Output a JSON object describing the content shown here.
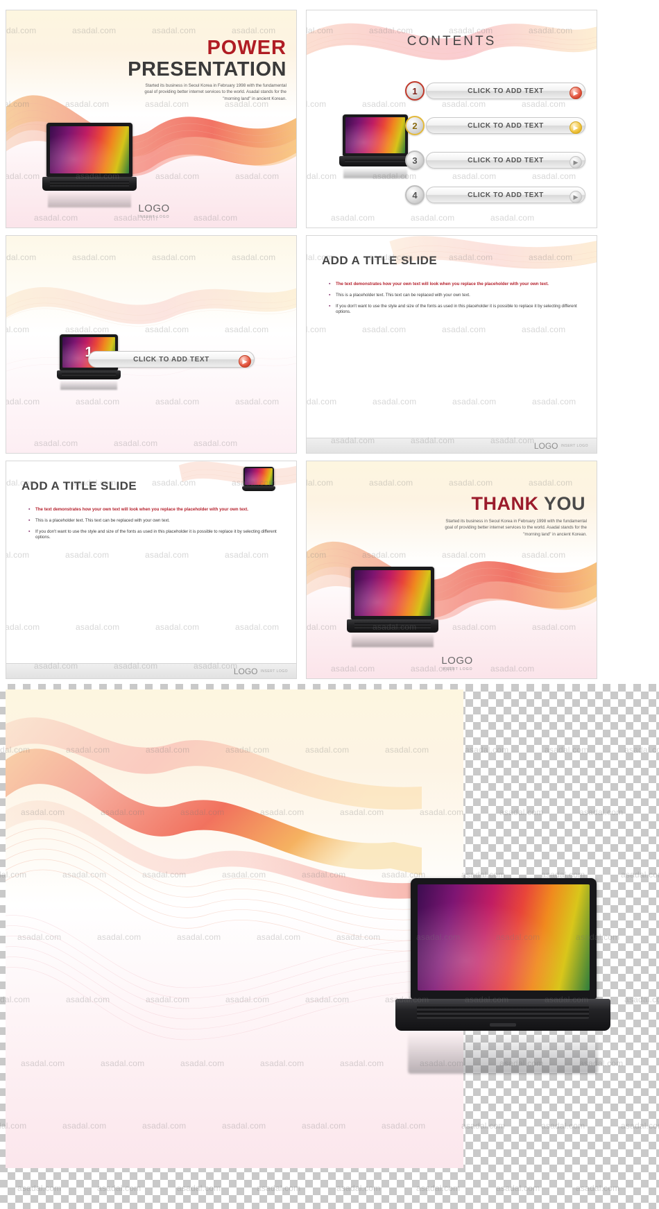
{
  "meta": {
    "watermark_text": "asadal.com"
  },
  "slides": [
    {
      "id": "slide-cover",
      "title_line1": "POWER",
      "title_line2": "PRESENTATION",
      "body": "Started its business in Seoul Korea in February 1998 with the fundamental goal of providing better internet services to the world. Asadal stands for the \"morning land\" in ancient Korean.",
      "logo": "LOGO",
      "logo_sub": "INSERT LOGO"
    },
    {
      "id": "slide-contents",
      "title": "CONTENTS",
      "rows": [
        {
          "num": "1",
          "label": "CLICK TO ADD TEXT"
        },
        {
          "num": "2",
          "label": "CLICK TO ADD TEXT"
        },
        {
          "num": "3",
          "label": "CLICK TO ADD TEXT"
        },
        {
          "num": "4",
          "label": "CLICK TO ADD TEXT"
        }
      ]
    },
    {
      "id": "slide-section",
      "num": "1",
      "label": "CLICK TO ADD TEXT"
    },
    {
      "id": "slide-title-a",
      "title": "ADD A TITLE SLIDE",
      "bullets": [
        "The text demonstrates how your own text will look when you replace the placeholder with your own text.",
        "This is a placeholder text. This text can be replaced with your own text.",
        "If you don't want to use the style and size of the fonts as used in this placeholder it is possible to replace it by selecting different options."
      ],
      "logo": "LOGO",
      "logo_sub": "INSERT LOGO"
    },
    {
      "id": "slide-title-b",
      "title": "ADD A TITLE SLIDE",
      "bullets": [
        "The text demonstrates how your own text will look when you replace the placeholder with your own text.",
        "This is a placeholder text. This text can be replaced with your own text.",
        "If you don't want to use the style and size of the fonts as used in this placeholder it is possible to replace it by selecting different options."
      ],
      "logo": "LOGO",
      "logo_sub": "INSERT LOGO"
    },
    {
      "id": "slide-thanks",
      "title_strong": "THANK",
      "title_rest": " YOU",
      "body": "Started its business in Seoul Korea in February 1998 with the fundamental goal of providing better internet services to the world. Asadal stands for the \"morning land\" in ancient Korean.",
      "logo": "LOGO",
      "logo_sub": "INSERT LOGO"
    }
  ],
  "colors": {
    "accent_red": "#b01c24",
    "accent_dark": "#3a3a3a",
    "bullet_red": "#b41f2b",
    "wave_orange": "#f4a03c",
    "wave_pink": "#f08aa0",
    "wave_red": "#e8413a"
  }
}
